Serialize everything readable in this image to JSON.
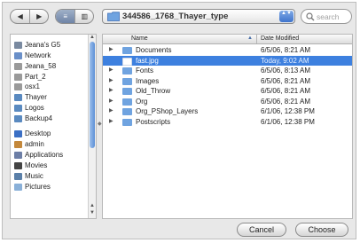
{
  "toolbar": {
    "back_glyph": "◀",
    "forward_glyph": "▶",
    "view_list_glyph": "≡",
    "view_column_glyph": "▥",
    "location": "344586_1768_Thayer_type",
    "location_arrows": "▲▼",
    "search_placeholder": "search"
  },
  "sidebar": {
    "items": [
      {
        "label": "Jeana's G5",
        "icon": "computer-icon",
        "color": "#7a8aa0"
      },
      {
        "label": "Network",
        "icon": "globe-icon",
        "color": "#6a8fc8"
      },
      {
        "label": "Jeana_58",
        "icon": "disk-icon",
        "color": "#9a9a9a"
      },
      {
        "label": "Part_2",
        "icon": "disk-icon",
        "color": "#9a9a9a"
      },
      {
        "label": "osx1",
        "icon": "disk-icon",
        "color": "#9a9a9a"
      },
      {
        "label": "Thayer",
        "icon": "network-disk-icon",
        "color": "#5a8ac0"
      },
      {
        "label": "Logos",
        "icon": "network-disk-icon",
        "color": "#5a8ac0"
      },
      {
        "label": "Backup4",
        "icon": "network-disk-icon",
        "color": "#5a8ac0"
      },
      {
        "label": "Desktop",
        "icon": "desktop-icon",
        "color": "#3b6fc4"
      },
      {
        "label": "admin",
        "icon": "home-icon",
        "color": "#c4883b"
      },
      {
        "label": "Applications",
        "icon": "applications-icon",
        "color": "#6d7fa6"
      },
      {
        "label": "Movies",
        "icon": "movies-icon",
        "color": "#444444"
      },
      {
        "label": "Music",
        "icon": "music-icon",
        "color": "#5a7fa8"
      },
      {
        "label": "Pictures",
        "icon": "pictures-icon",
        "color": "#8ab0d8"
      }
    ]
  },
  "list": {
    "col_name": "Name",
    "col_date": "Date Modified",
    "sort_glyph": "▲",
    "rows": [
      {
        "name": "Documents",
        "date": "6/5/06, 8:21 AM",
        "folder": true,
        "selected": false
      },
      {
        "name": "fast.jpg",
        "date": "Today, 9:02 AM",
        "folder": false,
        "selected": true
      },
      {
        "name": "Fonts",
        "date": "6/5/06, 8:13 AM",
        "folder": true,
        "selected": false
      },
      {
        "name": "Images",
        "date": "6/5/06, 8:21 AM",
        "folder": true,
        "selected": false
      },
      {
        "name": "Old_Throw",
        "date": "6/5/06, 8:21 AM",
        "folder": true,
        "selected": false
      },
      {
        "name": "Org",
        "date": "6/5/06, 8:21 AM",
        "folder": true,
        "selected": false
      },
      {
        "name": "Org_PShop_Layers",
        "date": "6/1/06, 12:38 PM",
        "folder": true,
        "selected": false
      },
      {
        "name": "Postscripts",
        "date": "6/1/06, 12:38 PM",
        "folder": true,
        "selected": false
      }
    ]
  },
  "buttons": {
    "cancel": "Cancel",
    "choose": "Choose"
  },
  "colors": {
    "selection": "#3d80df",
    "folder": "#6fa3e0",
    "scroll_thumb": "#5b8fd6"
  }
}
